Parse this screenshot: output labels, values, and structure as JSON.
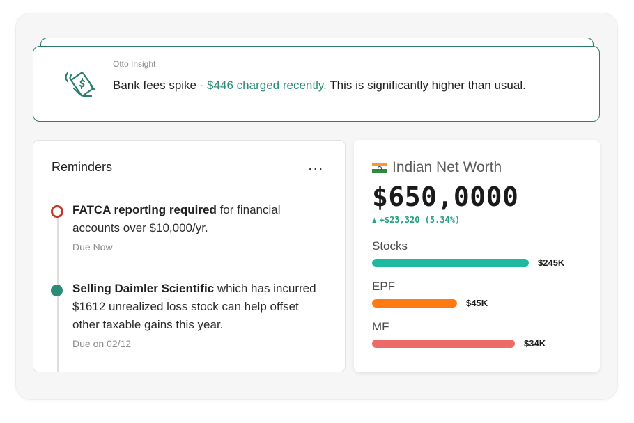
{
  "insight": {
    "eyebrow": "Otto Insight",
    "lead": "Bank fees spike",
    "separator": " - ",
    "highlight": "$446 charged recently.",
    "rest": " This is significantly higher than usual.",
    "icon": "hand-money-signal-icon",
    "accent_color": "#2a8c76"
  },
  "reminders": {
    "title": "Reminders",
    "more_label": "...",
    "items": [
      {
        "bold": "FATCA reporting required",
        "text": " for financial accounts over $10,000/yr.",
        "due": "Due Now",
        "status_color": "#c0392b"
      },
      {
        "bold": "Selling Daimler Scientific",
        "text": " which has incurred $1612 unrealized loss stock can help offset other taxable gains this year.",
        "due": "Due on 02/12",
        "status_color": "#2a8c76"
      }
    ]
  },
  "net_worth": {
    "flag": "india-flag-icon",
    "title": "Indian Net Worth",
    "value": "$650,0000",
    "change": "+$23,320 (5.34%)",
    "change_color": "#23a07f",
    "assets": [
      {
        "label": "Stocks",
        "amount": "$245K",
        "share": 1.0,
        "color": "#1fb8a0"
      },
      {
        "label": "EPF",
        "amount": "$45K",
        "share": 0.54,
        "color": "#ff7a12"
      },
      {
        "label": "MF",
        "amount": "$34K",
        "share": 0.91,
        "color": "#ee6a68"
      }
    ]
  }
}
